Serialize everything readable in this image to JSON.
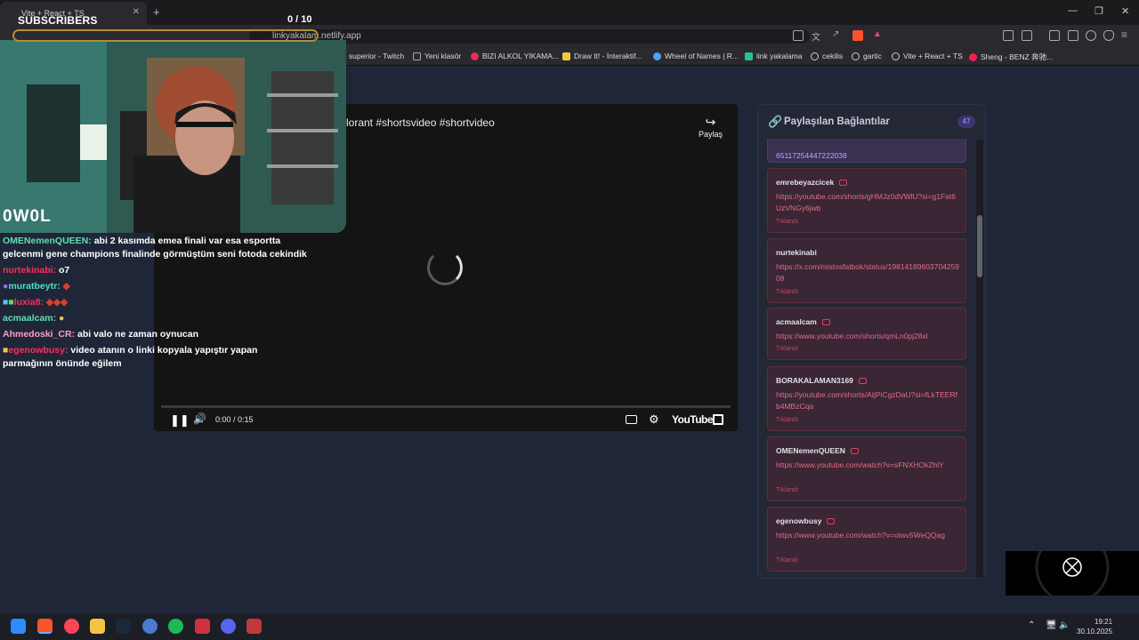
{
  "browser": {
    "tab_title": "Vite + React + TS",
    "url": "linkyakalam.netlify.app",
    "bookmarks": [
      {
        "label": "superior - Twitch",
        "color": "#9146ff"
      },
      {
        "label": "Yeni klasör",
        "color": "#888888"
      },
      {
        "label": "BIZI ALKOL YIKAMA...",
        "color": "#e0305a"
      },
      {
        "label": "Draw It! - İnteraktif...",
        "color": "#f2c744"
      },
      {
        "label": "Wheel of Names | R...",
        "color": "#4aa3ff"
      },
      {
        "label": "link yakalama",
        "color": "#28c28f"
      },
      {
        "label": "cekilis",
        "color": "#cccccc"
      },
      {
        "label": "gartic",
        "color": "#cccccc"
      },
      {
        "label": "Vite + React + TS",
        "color": "#cccccc"
      },
      {
        "label": "Sheng - BENZ 奔驰...",
        "color": "#ff2050"
      }
    ]
  },
  "video": {
    "title": "lorant #shortsvideo #shortvideo",
    "share_label": "Paylaş",
    "time": "0:00 / 0:15",
    "logo": "YouTube"
  },
  "panel": {
    "title": "Paylaşılan Bağlantılar",
    "count": "47",
    "partial_url": "65117254447222038",
    "items": [
      {
        "user": "emrebeyazcicek",
        "url": "https://youtube.com/shorts/gHMJz0dVWlU?si=g1Fat6UzVNGy6jwb",
        "status": "Tıklandı"
      },
      {
        "user": "nurtekinabi",
        "url": "https://x.com/mistosfatbok/status/1981418960370425908",
        "status": "Tıklandı"
      },
      {
        "user": "acmaalcam",
        "url": "https://www.youtube.com/shorts/qmLn0pj28xl",
        "status": "Tıklandı"
      },
      {
        "user": "BORAKALAMAN3169",
        "url": "https://youtube.com/shorts/AtjPiCgzDaU?si=fLkTEERfb4MBzCqa",
        "status": "Tıklandı"
      },
      {
        "user": "OMENemenQUEEN",
        "url": "https://www.youtube.com/watch?v=sFNXHOkZhlY",
        "status": "Tıklandı"
      },
      {
        "user": "egenowbusy",
        "url": "https://www.youtube.com/watch?v=olwv5WeQQag",
        "status": "Tıklandı"
      }
    ]
  },
  "stream": {
    "subs_label": "SUBSCRIBERS",
    "subs_count": "0 / 10",
    "subs_progress": 0,
    "brand": "0W0L"
  },
  "chat": [
    {
      "user": "OMENemenQUEEN:",
      "color": "#5fe0b0",
      "text": "abi 2 kasımda emea finali var esa esportta gelcenmi gene champions finalinde görmüştüm seni fotoda cekindik"
    },
    {
      "user": "nurtekinabi:",
      "color": "#ff2d5a",
      "text": "o7"
    },
    {
      "user": "muratbeytr:",
      "color": "#4ee0c8",
      "text": ""
    },
    {
      "user": "luxia8:",
      "color": "#ff2d5a",
      "text": ""
    },
    {
      "user": "acmaalcam:",
      "color": "#5fe0b0",
      "text": ""
    },
    {
      "user": "Ahmedoski_CR:",
      "color": "#ff9ec3",
      "text": "abi valo ne zaman oynucan"
    },
    {
      "user": "egenowbusy:",
      "color": "#ff2d5a",
      "text": "video atanın o linki kopyala yapıştır yapan parmağının önünde eğilem"
    }
  ],
  "taskbar": {
    "time": "19:21",
    "date": "30.10.2025"
  }
}
